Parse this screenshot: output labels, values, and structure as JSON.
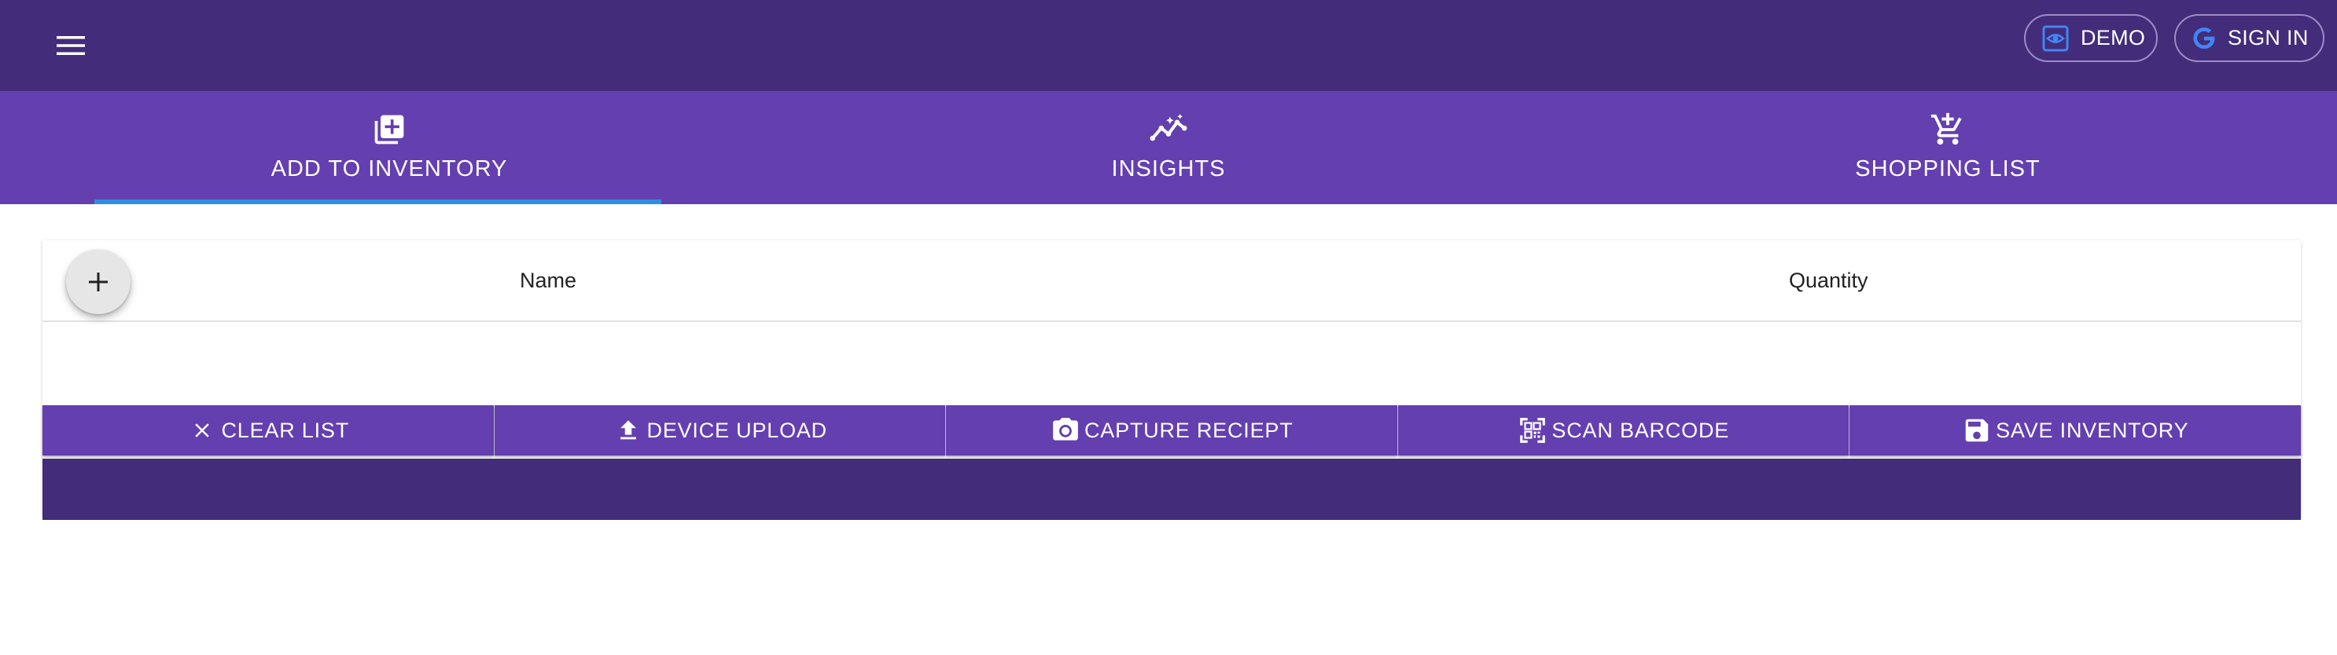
{
  "appbar": {
    "demo_label": "DEMO",
    "signin_label": "SIGN IN",
    "background": "#432c7a"
  },
  "tabs": [
    {
      "label": "ADD TO INVENTORY",
      "icon": "library-add-icon",
      "selected": true
    },
    {
      "label": "INSIGHTS",
      "icon": "insights-icon",
      "selected": false
    },
    {
      "label": "SHOPPING LIST",
      "icon": "add-shopping-cart-icon",
      "selected": false
    }
  ],
  "table": {
    "columns": [
      "Name",
      "Quantity"
    ],
    "rows": []
  },
  "actions": [
    {
      "label": "CLEAR LIST",
      "icon": "close-icon"
    },
    {
      "label": "DEVICE UPLOAD",
      "icon": "upload-icon"
    },
    {
      "label": "CAPTURE RECIEPT",
      "icon": "camera-icon"
    },
    {
      "label": "SCAN BARCODE",
      "icon": "qr-code-scanner-icon"
    },
    {
      "label": "SAVE INVENTORY",
      "icon": "save-icon"
    }
  ],
  "colors": {
    "primary": "#643fb0",
    "primary_dark": "#432c7a",
    "tab_indicator": "#2e8fe0",
    "google_blue": "#4285f4"
  }
}
